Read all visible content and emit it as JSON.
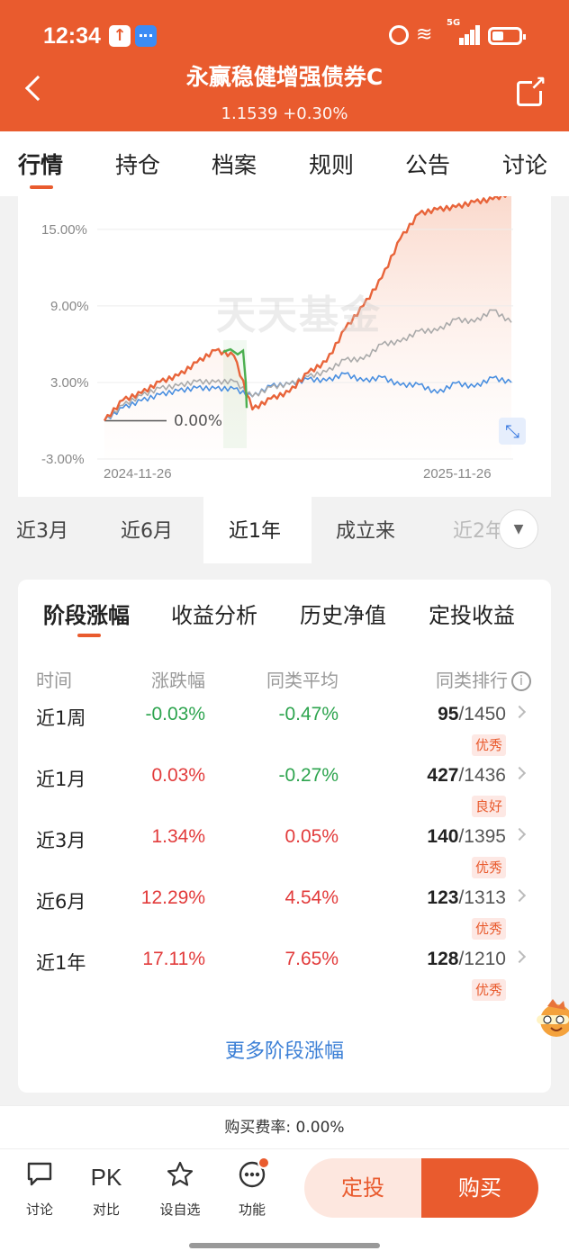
{
  "status": {
    "time": "12:34",
    "network": "5G"
  },
  "header": {
    "title": "永赢稳健增强债券C",
    "nav": "1.1539 +0.30%"
  },
  "tabs": [
    "行情",
    "持仓",
    "档案",
    "规则",
    "公告",
    "讨论"
  ],
  "chart": {
    "y_ticks": [
      "15.00%",
      "9.00%",
      "3.00%",
      "-3.00%"
    ],
    "x_start": "2024-11-26",
    "x_end": "2025-11-26",
    "watermark": "天天基金",
    "zero_label": "0.00%",
    "colors": {
      "fund": "#e8643a",
      "peer_avg": "#aaaaaa",
      "benchmark": "#4a8fe0",
      "highlight": "#4caf50"
    }
  },
  "chart_data": {
    "type": "line",
    "x_range": [
      "2024-11-26",
      "2025-11-26"
    ],
    "ylim": [
      -3,
      18
    ],
    "ytick_labels": [
      "15.00%",
      "9.00%",
      "3.00%",
      "-3.00%"
    ],
    "xtick_labels": [
      "2024-11-26",
      "2025-11-26"
    ],
    "grid": true,
    "series": [
      {
        "color": "#e8643a",
        "values": [
          0,
          1.6,
          2.2,
          3.0,
          3.6,
          4.5,
          5.6,
          5.0,
          1.0,
          1.6,
          2.4,
          3.6,
          4.8,
          7.0,
          9.2,
          11.0,
          14.5,
          16.0,
          16.8,
          16.5,
          17.4,
          17.1,
          17.9
        ]
      },
      {
        "color": "#aaaaaa",
        "values": [
          0,
          1.2,
          2.0,
          2.5,
          2.8,
          3.0,
          3.1,
          3.0,
          2.0,
          2.5,
          3.0,
          3.3,
          4.0,
          4.6,
          5.0,
          5.8,
          6.4,
          6.8,
          7.3,
          7.7,
          8.0,
          8.4,
          7.7
        ]
      },
      {
        "color": "#4a8fe0",
        "values": [
          0,
          1.0,
          1.6,
          2.0,
          2.4,
          2.5,
          2.6,
          2.4,
          2.0,
          2.6,
          3.0,
          3.1,
          3.3,
          3.5,
          3.3,
          3.2,
          3.0,
          2.6,
          2.4,
          2.7,
          2.9,
          3.1,
          3.0
        ]
      }
    ]
  },
  "periods": [
    "近3月",
    "近6月",
    "近1年",
    "成立来",
    "近2年"
  ],
  "returns": {
    "tabs": [
      "阶段涨幅",
      "收益分析",
      "历史净值",
      "定投收益"
    ],
    "headers": {
      "period": "时间",
      "change": "涨跌幅",
      "avg": "同类平均",
      "rank": "同类排行"
    },
    "rows": [
      {
        "period": "近1周",
        "change": "-0.03%",
        "avg": "-0.47%",
        "rank": "95",
        "total": "/1450",
        "badge": "优秀"
      },
      {
        "period": "近1月",
        "change": "0.03%",
        "avg": "-0.27%",
        "rank": "427",
        "total": "/1436",
        "badge": "良好"
      },
      {
        "period": "近3月",
        "change": "1.34%",
        "avg": "0.05%",
        "rank": "140",
        "total": "/1395",
        "badge": "优秀"
      },
      {
        "period": "近6月",
        "change": "12.29%",
        "avg": "4.54%",
        "rank": "123",
        "total": "/1313",
        "badge": "优秀"
      },
      {
        "period": "近1年",
        "change": "17.11%",
        "avg": "7.65%",
        "rank": "128",
        "total": "/1210",
        "badge": "优秀"
      }
    ],
    "more": "更多阶段涨幅"
  },
  "fee": "购买费率: 0.00%",
  "bottom": {
    "items": [
      {
        "label": "讨论",
        "icon": "chat-icon"
      },
      {
        "label": "对比",
        "icon": "pk-icon",
        "glyph": "PK"
      },
      {
        "label": "设自选",
        "icon": "star-icon"
      },
      {
        "label": "功能",
        "icon": "more-icon"
      }
    ],
    "plan": "定投",
    "buy": "购买"
  }
}
